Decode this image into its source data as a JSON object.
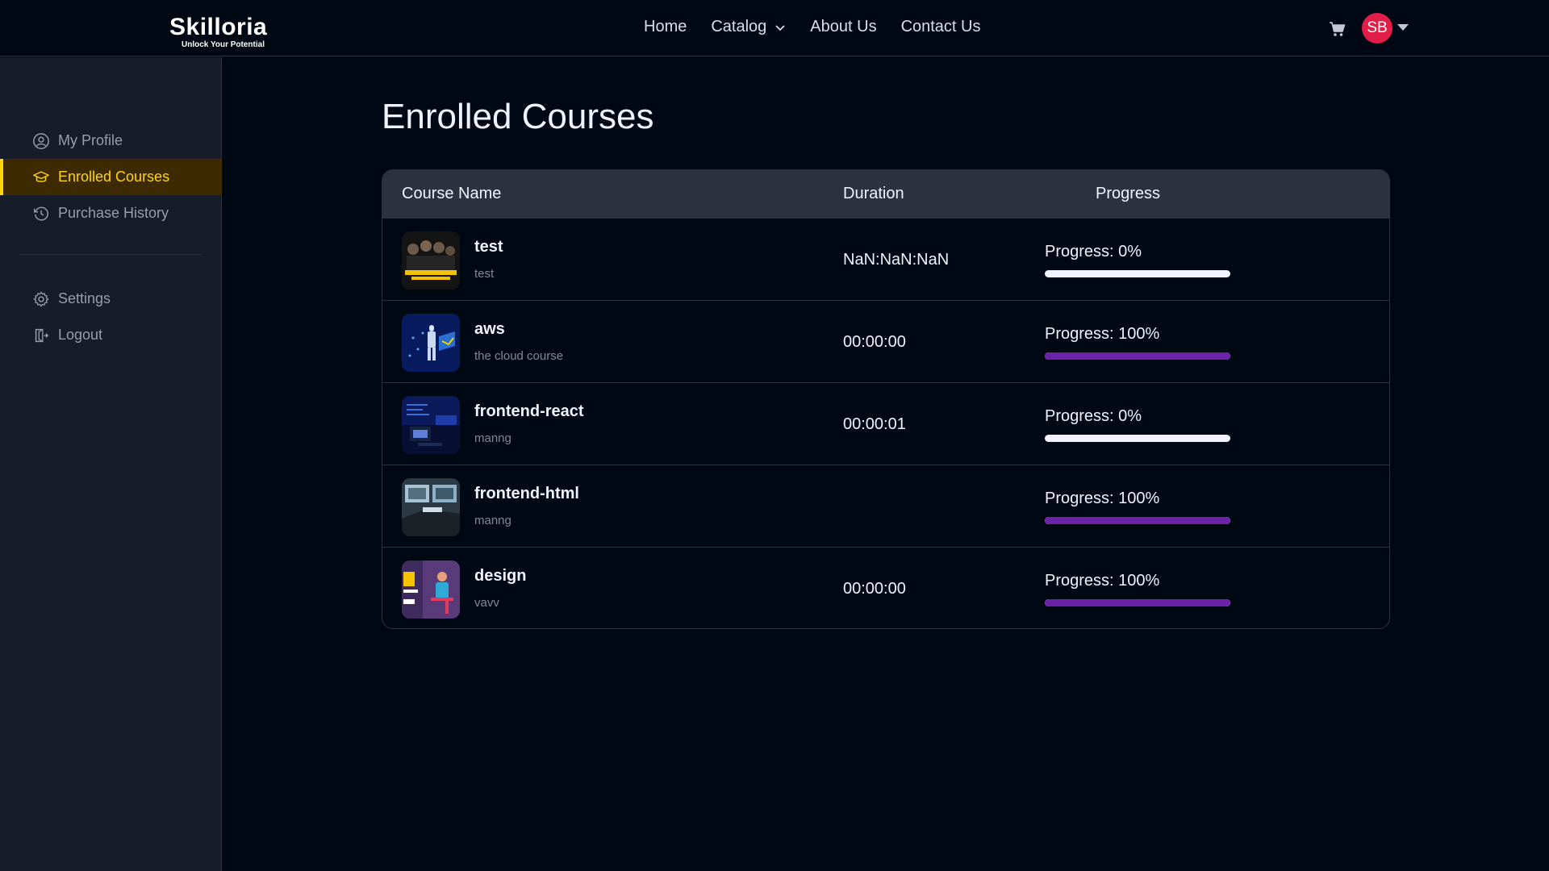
{
  "brand": {
    "name": "Skilloria",
    "tagline": "Unlock Your Potential"
  },
  "nav": {
    "items": [
      "Home",
      "Catalog",
      "About Us",
      "Contact Us"
    ]
  },
  "user": {
    "initials": "SB",
    "avatar_color": "#e11d48"
  },
  "icons": {
    "cart": "cart-icon",
    "caret": "caret-down-icon"
  },
  "sidebar": {
    "items": [
      {
        "label": "My Profile",
        "icon": "user-circle-icon"
      },
      {
        "label": "Enrolled Courses",
        "icon": "graduation-cap-icon",
        "active": true
      },
      {
        "label": "Purchase History",
        "icon": "history-icon"
      },
      {
        "label": "Settings",
        "icon": "gear-icon"
      },
      {
        "label": "Logout",
        "icon": "logout-icon"
      }
    ]
  },
  "page": {
    "title": "Enrolled Courses"
  },
  "table": {
    "headers": {
      "course": "Course Name",
      "duration": "Duration",
      "progress": "Progress"
    },
    "rows": [
      {
        "title": "test",
        "description": "test",
        "duration": "NaN:NaN:NaN",
        "progress_label": "Progress: 0%",
        "progress": 0
      },
      {
        "title": "aws",
        "description": "the cloud course",
        "duration": "00:00:00",
        "progress_label": "Progress: 100%",
        "progress": 100
      },
      {
        "title": "frontend-react",
        "description": "manng",
        "duration": "00:00:01",
        "progress_label": "Progress: 0%",
        "progress": 0
      },
      {
        "title": "frontend-html",
        "description": "manng",
        "duration": "",
        "progress_label": "Progress: 100%",
        "progress": 100
      },
      {
        "title": "design",
        "description": "vavv",
        "duration": "00:00:00",
        "progress_label": "Progress: 100%",
        "progress": 100
      }
    ]
  },
  "colors": {
    "background": "#000814",
    "sidebar": "#161d29",
    "active": "#ffd60a",
    "progress": "#6b21a8"
  }
}
